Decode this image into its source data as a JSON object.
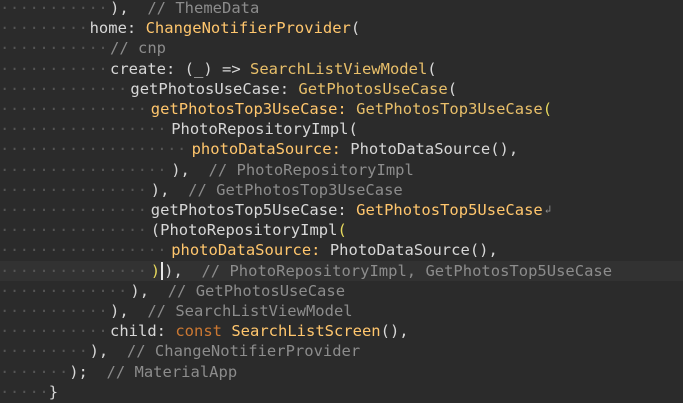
{
  "editor": {
    "language": "Dart",
    "lines": [
      {
        "indent": 5,
        "tokens": [
          [
            "punc",
            "),"
          ],
          [
            "cmt",
            "  // ThemeData"
          ]
        ]
      },
      {
        "indent": 4,
        "tokens": [
          [
            "id",
            "home: "
          ],
          [
            "named",
            "ChangeNotifierProvider"
          ],
          [
            "punc",
            "("
          ]
        ]
      },
      {
        "indent": 5,
        "tokens": [
          [
            "cmt",
            "// cnp"
          ]
        ]
      },
      {
        "indent": 5,
        "tokens": [
          [
            "id",
            "create: "
          ],
          [
            "punc",
            "(_) => "
          ],
          [
            "cls",
            "SearchListViewModel"
          ],
          [
            "punc",
            "("
          ]
        ]
      },
      {
        "indent": 6,
        "tokens": [
          [
            "id",
            "getPhotosUseCase: "
          ],
          [
            "cls",
            "GetPhotosUseCase"
          ],
          [
            "punc",
            "("
          ]
        ]
      },
      {
        "indent": 7,
        "tokens": [
          [
            "named",
            "getPhotosTop3UseCase: "
          ],
          [
            "cls",
            "GetPhotosTop3UseCase"
          ],
          [
            "rainbow-y",
            "("
          ]
        ]
      },
      {
        "indent": 8,
        "tokens": [
          [
            "id",
            "PhotoRepositoryImpl"
          ],
          [
            "punc",
            "("
          ]
        ]
      },
      {
        "indent": 9,
        "tokens": [
          [
            "named",
            "photoDataSource: "
          ],
          [
            "id",
            "PhotoDataSource"
          ],
          [
            "punc",
            "(),"
          ]
        ]
      },
      {
        "indent": 8,
        "tokens": [
          [
            "punc",
            "),"
          ],
          [
            "cmt",
            "  // PhotoRepositoryImpl"
          ]
        ]
      },
      {
        "indent": 7,
        "tokens": [
          [
            "punc",
            "),"
          ],
          [
            "cmt",
            "  // GetPhotosTop3UseCase"
          ]
        ]
      },
      {
        "indent": 7,
        "tokens": [
          [
            "id",
            "getPhotosTop5UseCase: "
          ],
          [
            "named",
            "GetPhotosTop5UseCase"
          ],
          [
            "wrap",
            "↲"
          ]
        ]
      },
      {
        "indent": 7,
        "tokens": [
          [
            "id",
            "("
          ],
          [
            "id",
            "PhotoRepositoryImpl"
          ],
          [
            "rainbow-y",
            "("
          ]
        ]
      },
      {
        "indent": 8,
        "tokens": [
          [
            "named",
            "photoDataSource: "
          ],
          [
            "id",
            "PhotoDataSource"
          ],
          [
            "punc",
            "(),"
          ]
        ]
      },
      {
        "indent": 7,
        "current": true,
        "tokens": [
          [
            "rainbow-y",
            ")"
          ],
          [
            "cursor",
            ""
          ],
          [
            "punc",
            "),"
          ],
          [
            "cmt",
            "  // PhotoRepositoryImpl, GetPhotosTop5UseCase"
          ]
        ]
      },
      {
        "indent": 6,
        "tokens": [
          [
            "punc",
            "),"
          ],
          [
            "cmt",
            "  // GetPhotosUseCase"
          ]
        ]
      },
      {
        "indent": 5,
        "tokens": [
          [
            "punc",
            "),"
          ],
          [
            "cmt",
            "  // SearchListViewModel"
          ]
        ]
      },
      {
        "indent": 5,
        "tokens": [
          [
            "id",
            "child: "
          ],
          [
            "kw",
            "const "
          ],
          [
            "named",
            "SearchListScreen"
          ],
          [
            "punc",
            "(),"
          ]
        ]
      },
      {
        "indent": 4,
        "tokens": [
          [
            "punc",
            "),"
          ],
          [
            "cmt",
            "  // ChangeNotifierProvider"
          ]
        ]
      },
      {
        "indent": 3,
        "tokens": [
          [
            "punc",
            ");"
          ],
          [
            "cmt",
            "  // MaterialApp"
          ]
        ]
      },
      {
        "indent": 2,
        "tokens": [
          [
            "punc",
            "}"
          ]
        ]
      }
    ]
  }
}
